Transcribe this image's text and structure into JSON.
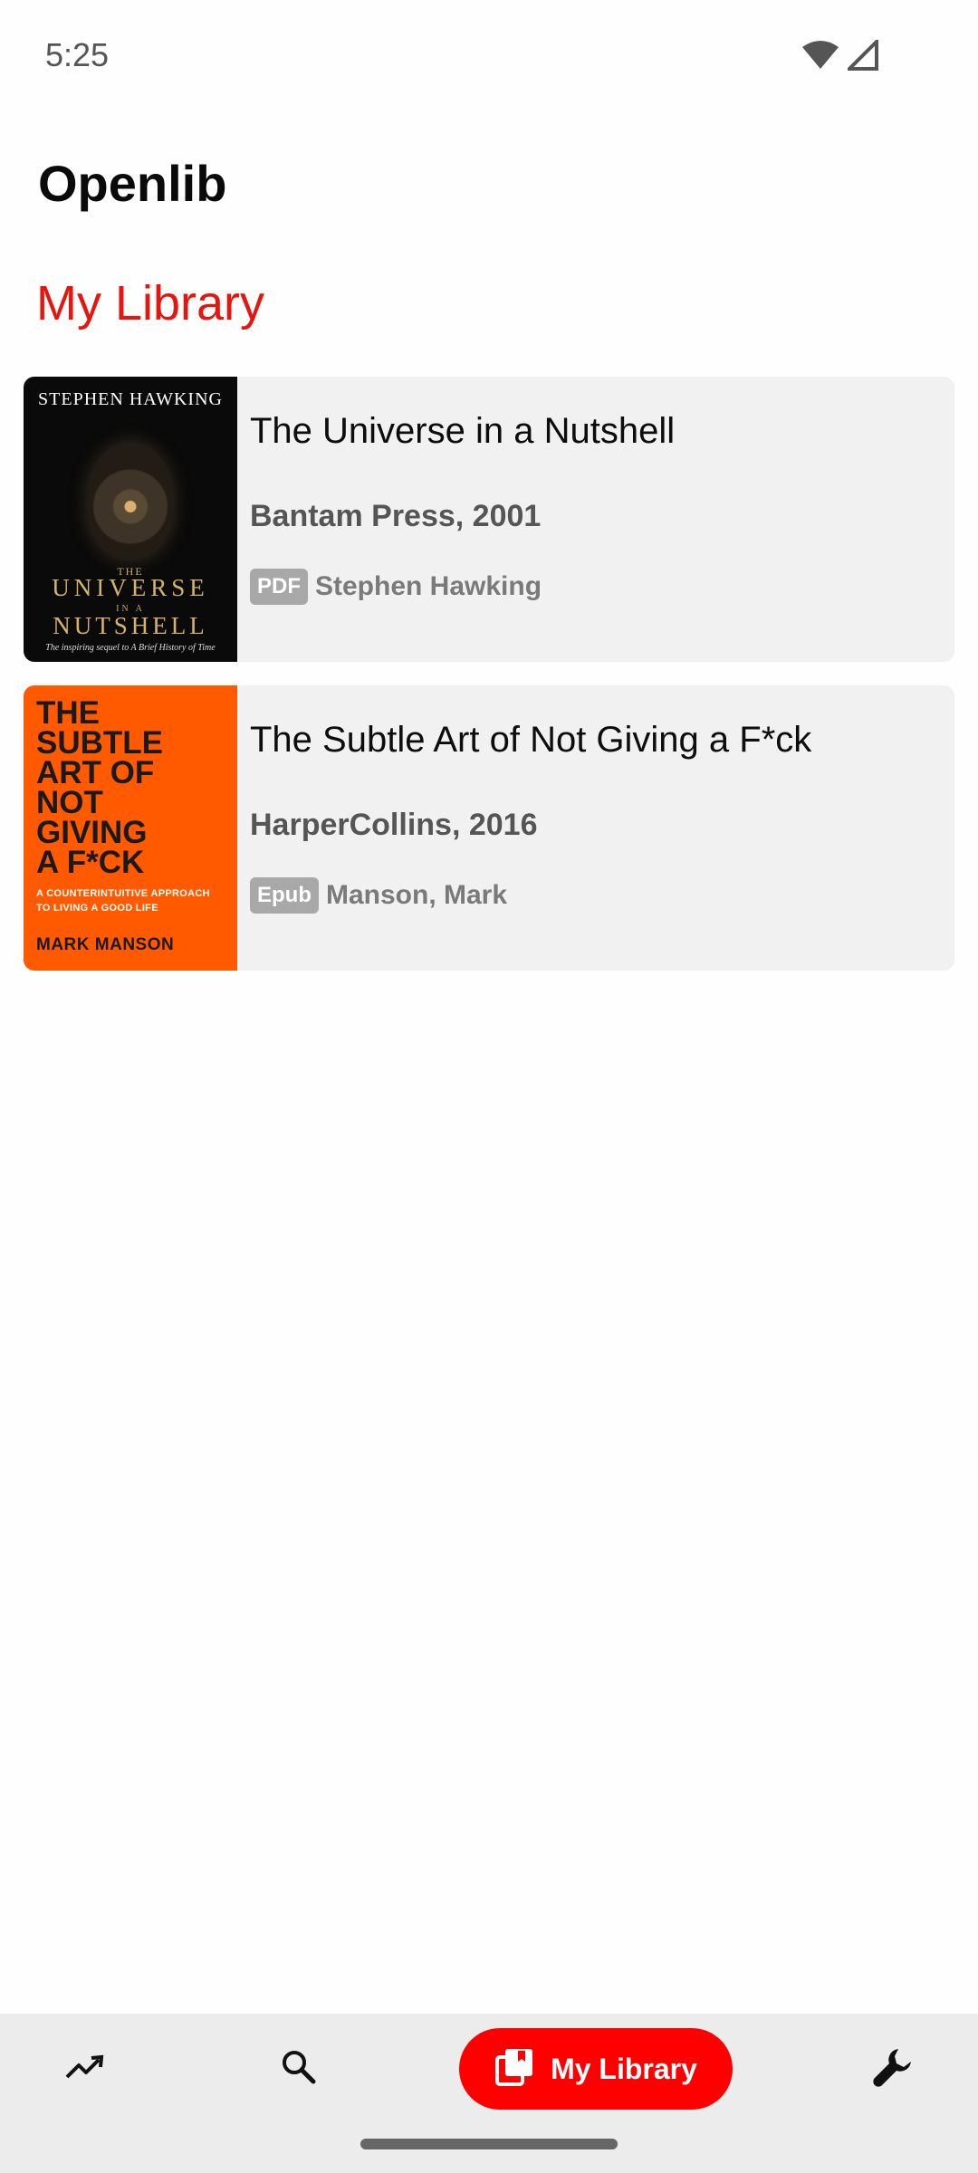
{
  "status_bar": {
    "time": "5:25",
    "icons": [
      "wifi-icon",
      "cellular-signal-icon"
    ]
  },
  "app": {
    "title": "Openlib"
  },
  "section": {
    "title": "My Library",
    "accent_color": "#e5150f"
  },
  "books": [
    {
      "title": "The Universe in a Nutshell",
      "publisher": "Bantam Press, 2001",
      "format": "PDF",
      "author": "Stephen Hawking",
      "cover": {
        "author": "STEPHEN HAWKING",
        "the": "THE",
        "line1": "UNIVERSE",
        "in_a": "IN A",
        "line2": "NUTSHELL",
        "tagline": "The inspiring sequel to A Brief History of Time"
      }
    },
    {
      "title": "The Subtle Art of Not Giving a F*ck",
      "publisher": "HarperCollins, 2016",
      "format": "Epub",
      "author": "Manson, Mark",
      "cover": {
        "lines": [
          "THE",
          "SUBTLE",
          "ART OF",
          "NOT",
          "GIVING",
          "A F*CK"
        ],
        "sub1": "A COUNTERINTUITIVE APPROACH",
        "sub2": "TO LIVING A GOOD LIFE",
        "author": "MARK MANSON"
      }
    }
  ],
  "bottom_nav": {
    "items": [
      {
        "icon": "trending-icon",
        "label": ""
      },
      {
        "icon": "search-icon",
        "label": ""
      },
      {
        "icon": "library-icon",
        "label": "My Library",
        "active": true
      },
      {
        "icon": "wrench-icon",
        "label": ""
      }
    ],
    "active_color": "#ff0000"
  }
}
